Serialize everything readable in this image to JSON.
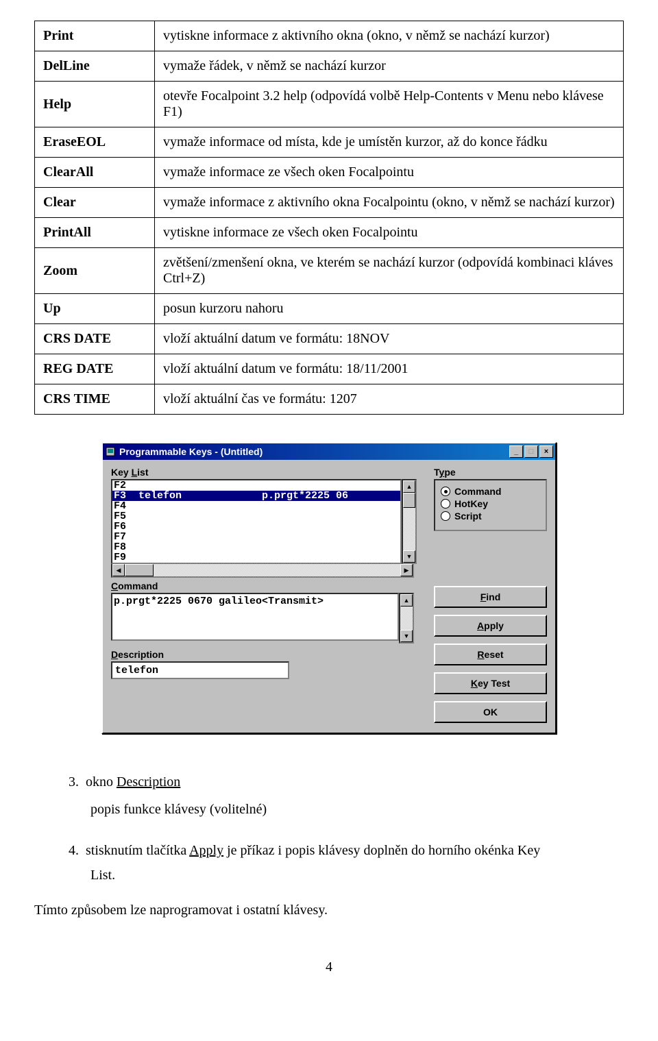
{
  "table_rows": [
    {
      "label": "Print",
      "desc": "vytiskne informace z aktivního okna (okno, v němž se nachází kurzor)"
    },
    {
      "label": "DelLine",
      "desc": "vymaže řádek, v němž se nachází kurzor"
    },
    {
      "label": "Help",
      "desc": "otevře Focalpoint 3.2 help (odpovídá volbě Help-Contents v Menu nebo klávese F1)"
    },
    {
      "label": "EraseEOL",
      "desc": "vymaže informace od místa, kde je umístěn kurzor, až do konce řádku"
    },
    {
      "label": "ClearAll",
      "desc": "vymaže informace ze všech oken Focalpointu"
    },
    {
      "label": "Clear",
      "desc": "vymaže informace z aktivního okna Focalpointu (okno, v němž se nachází kurzor)"
    },
    {
      "label": "PrintAll",
      "desc": "vytiskne informace ze všech oken Focalpointu"
    },
    {
      "label": "Zoom",
      "desc": "zvětšení/zmenšení okna, ve kterém se nachází kurzor (odpovídá kombinaci kláves Ctrl+Z)"
    },
    {
      "label": "Up",
      "desc": "posun kurzoru nahoru"
    },
    {
      "label": "CRS DATE",
      "desc": "vloží aktuální datum ve formátu: 18NOV"
    },
    {
      "label": "REG DATE",
      "desc": "vloží aktuální datum ve formátu: 18/11/2001"
    },
    {
      "label": "CRS TIME",
      "desc": "vloží aktuální čas ve formátu: 1207"
    }
  ],
  "dialog": {
    "title": "Programmable Keys - (Untitled)",
    "labels": {
      "key_list": "Key List",
      "type": "Type",
      "command": "Command",
      "description": "Description"
    },
    "key_list": {
      "items": [
        {
          "key": "F2",
          "text": ""
        },
        {
          "key": "F3",
          "text": "  telefon             p.prgt*2225 06",
          "selected": true
        },
        {
          "key": "F4",
          "text": ""
        },
        {
          "key": "F5",
          "text": ""
        },
        {
          "key": "F6",
          "text": ""
        },
        {
          "key": "F7",
          "text": ""
        },
        {
          "key": "F8",
          "text": ""
        },
        {
          "key": "F9",
          "text": ""
        }
      ]
    },
    "type_options": [
      {
        "label": "Command",
        "checked": true
      },
      {
        "label": "HotKey",
        "checked": false
      },
      {
        "label": "Script",
        "checked": false
      }
    ],
    "buttons": {
      "find": "Find",
      "apply": "Apply",
      "reset": "Reset",
      "key_test": "Key Test",
      "ok": "OK"
    },
    "command_value": "p.prgt*2225 0670 galileo<Transmit>",
    "description_value": "telefon"
  },
  "instructions": {
    "item3_num": "3.",
    "item3_a": "okno ",
    "item3_b": "Description",
    "item3_sub": "popis funkce klávesy (volitelné)",
    "item4_num": "4.",
    "item4_a": "stisknutím tlačítka ",
    "item4_b": "Apply",
    "item4_c": " je příkaz i popis klávesy doplněn do horního okénka Key",
    "item4_d": "List.",
    "final": "Tímto způsobem lze naprogramovat i ostatní klávesy."
  },
  "page_number": "4"
}
